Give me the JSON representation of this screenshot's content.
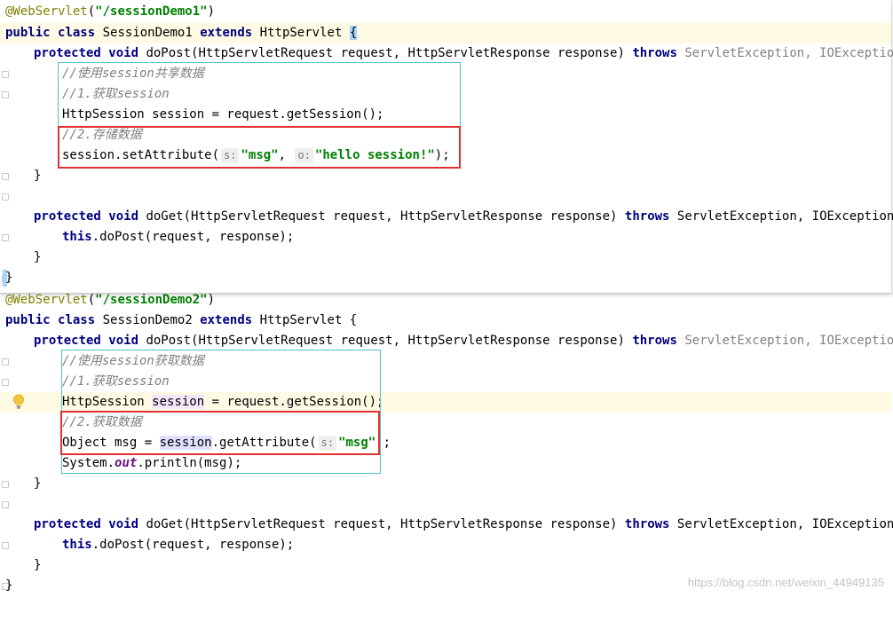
{
  "demo1": {
    "annotation": "@WebServlet",
    "annotation_value": "\"/sessionDemo1\"",
    "class_name": "SessionDemo1",
    "superclass": "HttpServlet",
    "dopost_signature": "doPost(HttpServletRequest request, HttpServletResponse response)",
    "exceptions": "ServletException, IOException {",
    "comment_share": "//使用session共享数据",
    "comment_step1": "//1.获取session",
    "get_session_line": "HttpSession session = request.getSession();",
    "comment_step2": "//2.存储数据",
    "set_attr_prefix": "session.setAttribute(",
    "hint_s": "s:",
    "key": "\"msg\"",
    "hint_o": "o:",
    "value": "\"hello session!\"",
    "set_attr_suffix": ");",
    "doget_signature": "doGet(HttpServletRequest request, HttpServletResponse response)",
    "doget_exceptions": "ServletException, IOException {",
    "this_kw": "this",
    "dopost_call": ".doPost(request, response);"
  },
  "demo2": {
    "annotation": "@WebServlet",
    "annotation_value": "\"/sessionDemo2\"",
    "class_name": "SessionDemo2",
    "superclass": "HttpServlet {",
    "dopost_signature": "doPost(HttpServletRequest request, HttpServletResponse response)",
    "exceptions": "ServletException, IOException {",
    "comment_get": "//使用session获取数据",
    "comment_step1": "//1.获取session",
    "session_type": "HttpSession",
    "session_var": "session",
    "get_session_rest": " = request.getSession();",
    "comment_step2": "//2.获取数据",
    "object_decl": "Object msg = ",
    "get_attr_rest": ".getAttribute(",
    "hint_s": "s:",
    "key": "\"msg\"",
    "suffix": ");",
    "system": "System.",
    "out": "out",
    "println": ".println(msg);",
    "doget_signature": "doGet(HttpServletRequest request, HttpServletResponse response)",
    "doget_exceptions": "ServletException, IOException {",
    "this_kw": "this",
    "dopost_call": ".doPost(request, response);"
  },
  "keywords": {
    "public": "public",
    "class": "class",
    "extends": "extends",
    "protected": "protected",
    "void": "void",
    "throws": "throws"
  },
  "braces": {
    "close": "}",
    "open": "{",
    "paren_open": "(",
    "paren_close": ")"
  },
  "watermark": "https://blog.csdn.net/weixin_44949135"
}
